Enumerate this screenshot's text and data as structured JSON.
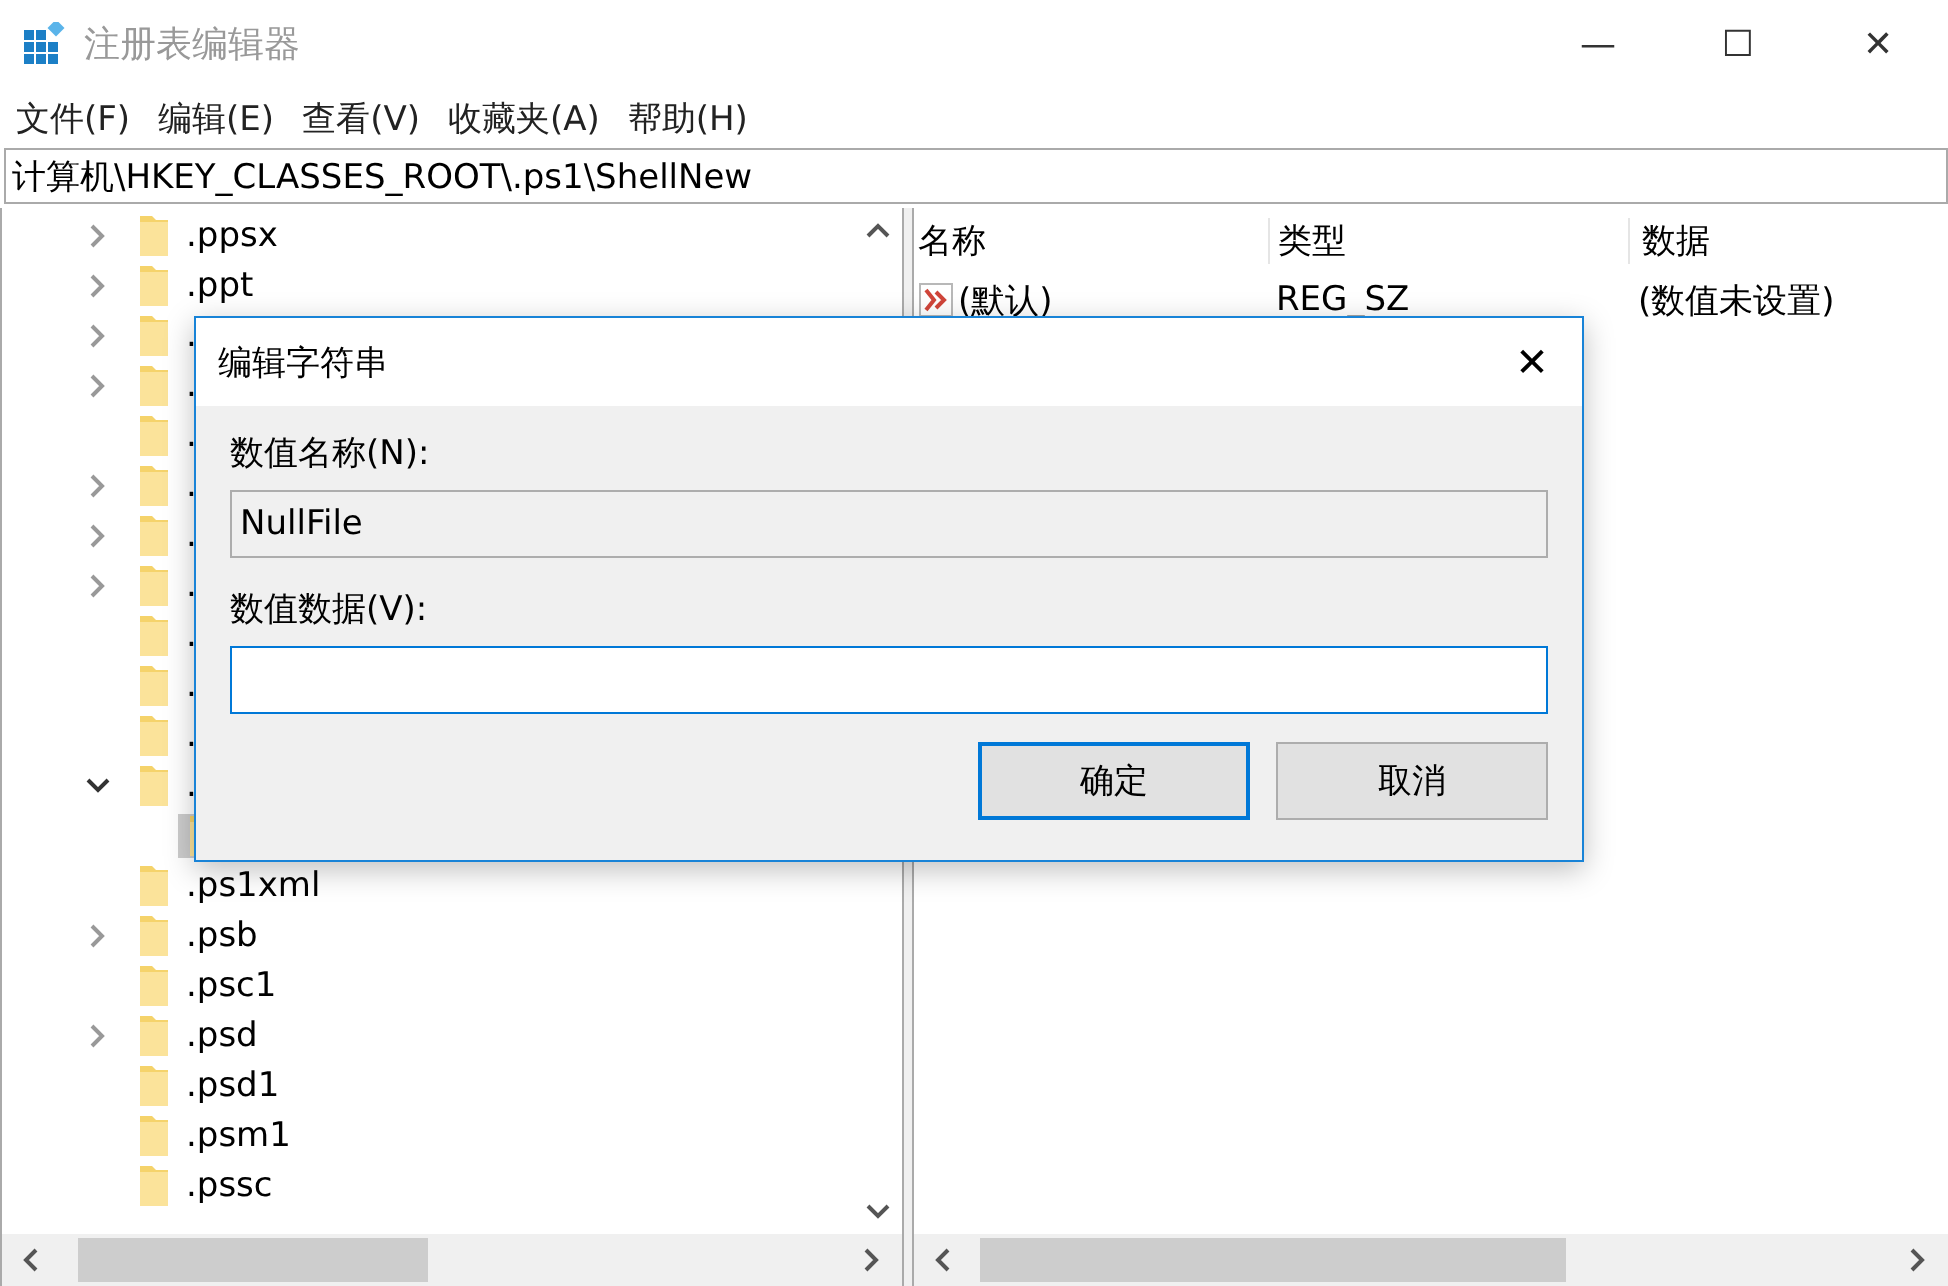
{
  "window": {
    "title": "注册表编辑器",
    "controls": [
      "—",
      "☐",
      "✕"
    ]
  },
  "menu": [
    "文件(F)",
    "编辑(E)",
    "查看(V)",
    "收藏夹(A)",
    "帮助(H)"
  ],
  "address": "计算机\\HKEY_CLASSES_ROOT\\.ps1\\ShellNew",
  "tree": {
    "items": [
      {
        "label": ".ppsx",
        "expandable": true,
        "expanded": false
      },
      {
        "label": ".ppt",
        "expandable": true,
        "expanded": false
      },
      {
        "label": ".",
        "expandable": true,
        "expanded": false
      },
      {
        "label": ".",
        "expandable": true,
        "expanded": false
      },
      {
        "label": ".",
        "expandable": false
      },
      {
        "label": ".",
        "expandable": true,
        "expanded": false
      },
      {
        "label": ".",
        "expandable": true,
        "expanded": false
      },
      {
        "label": ".",
        "expandable": true,
        "expanded": false
      },
      {
        "label": ".",
        "expandable": false
      },
      {
        "label": ".",
        "expandable": false
      },
      {
        "label": ".",
        "expandable": false
      },
      {
        "label": ".",
        "expandable": true,
        "expanded": true,
        "children": [
          {
            "selected": true
          }
        ]
      },
      {
        "label": ".ps1xml",
        "expandable": false
      },
      {
        "label": ".psb",
        "expandable": true,
        "expanded": false
      },
      {
        "label": ".psc1",
        "expandable": false
      },
      {
        "label": ".psd",
        "expandable": true,
        "expanded": false
      },
      {
        "label": ".psd1",
        "expandable": false
      },
      {
        "label": ".psm1",
        "expandable": false
      },
      {
        "label": ".pssc",
        "expandable": false
      }
    ]
  },
  "list": {
    "columns": [
      "名称",
      "类型",
      "数据"
    ],
    "rows": [
      {
        "name": "(默认)",
        "type": "REG_SZ",
        "data": "(数值未设置)"
      }
    ]
  },
  "dialog": {
    "title": "编辑字符串",
    "close": "✕",
    "name_label": "数值名称(N):",
    "name_value": "NullFile",
    "data_label": "数值数据(V):",
    "buttons": [
      {
        "label": "确定",
        "default": true
      },
      {
        "label": "取消",
        "default": false
      }
    ]
  }
}
